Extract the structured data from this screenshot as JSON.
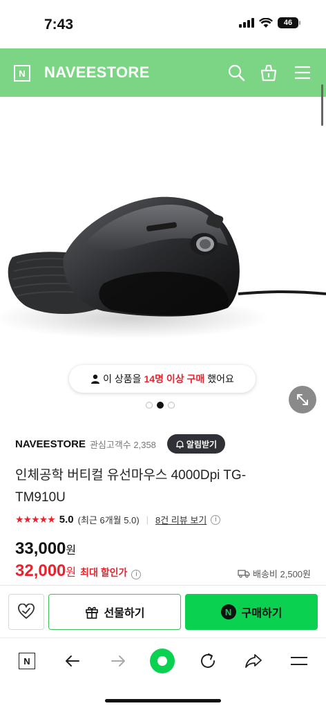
{
  "status": {
    "time": "7:43",
    "battery": "46"
  },
  "header": {
    "logo": "N",
    "brand": "NAVEESTORE"
  },
  "hero": {
    "buyer_prefix": "이 상품을",
    "buyer_highlight": "14명 이상 구매",
    "buyer_suffix": "했어요",
    "slide_count": 3,
    "active_slide": 2
  },
  "store": {
    "name": "NAVEESTORE",
    "interest_label": "관심고객수 2,358",
    "alert_label": "알림받기"
  },
  "product": {
    "title": "인체공학 버티컬 유선마우스 4000Dpi TG-TM910U",
    "stars": "★★★★★",
    "score": "5.0",
    "recent": "(최근 6개월 5.0)",
    "review_link": "8건 리뷰 보기",
    "orig_price": "33,000",
    "orig_won": "원",
    "sale_price": "32,000",
    "sale_won": "원",
    "sale_label": "최대 할인가",
    "shipping": "배송비 2,500원"
  },
  "actions": {
    "gift": "선물하기",
    "buy": "구매하기",
    "npay": "N"
  },
  "colors": {
    "header": "#7bd585",
    "accent_red": "#e8232d",
    "buy_green": "#0ad14f"
  }
}
